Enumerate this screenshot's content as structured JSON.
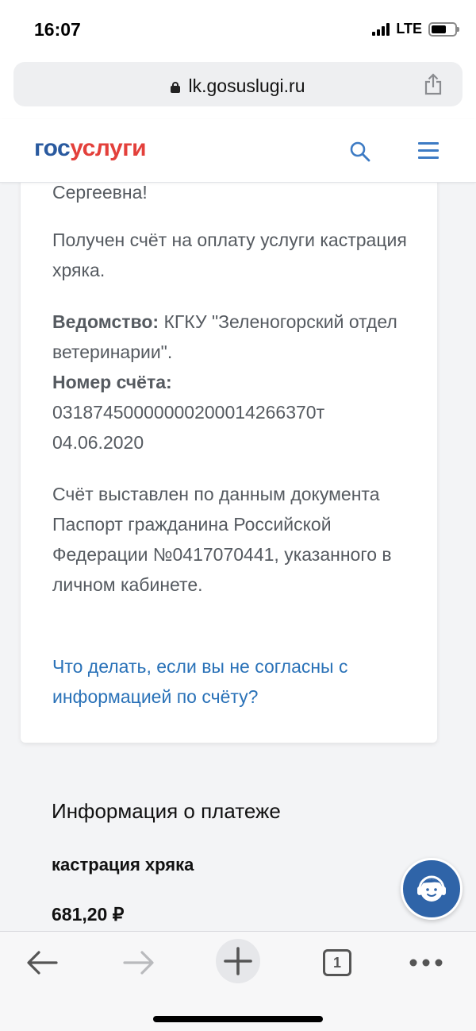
{
  "status_bar": {
    "time": "16:07",
    "network": "LTE"
  },
  "browser": {
    "url": "lk.gosuslugi.ru"
  },
  "site": {
    "logo_part1": "гос",
    "logo_part2": "услуги"
  },
  "card": {
    "greeting": "Сергеевна!",
    "message": "Получен счёт на оплату услуги кастрация хряка.",
    "dept_label": "Ведомство:",
    "dept_value": " КГКУ \"Зеленогорский отдел ветеринарии\".",
    "account_label": "Номер счёта:",
    "account_value": "03187450000000200014266370т 04.06.2020",
    "document_text": "Счёт выставлен по данным документа Паспорт гражданина Российской Федерации №0417070441, указанного в личном кабинете.",
    "help_link": "Что делать, если вы не согласны с информацией по счёту?"
  },
  "payment": {
    "title": "Информация о платеже",
    "service": "кастрация хряка",
    "amount": "681,20 ₽"
  },
  "toolbar": {
    "tab_count": "1"
  },
  "icons": {
    "search": "search-icon",
    "menu": "menu-icon",
    "share": "share-icon",
    "lock": "lock-icon",
    "support": "support-operator-icon",
    "back": "back-arrow-icon",
    "forward": "forward-arrow-icon",
    "new_tab": "plus-icon",
    "tabs": "tabs-icon",
    "more": "more-icon"
  },
  "colors": {
    "brand_blue": "#2a5a9f",
    "brand_red": "#e3403b",
    "link": "#2a72b8"
  }
}
